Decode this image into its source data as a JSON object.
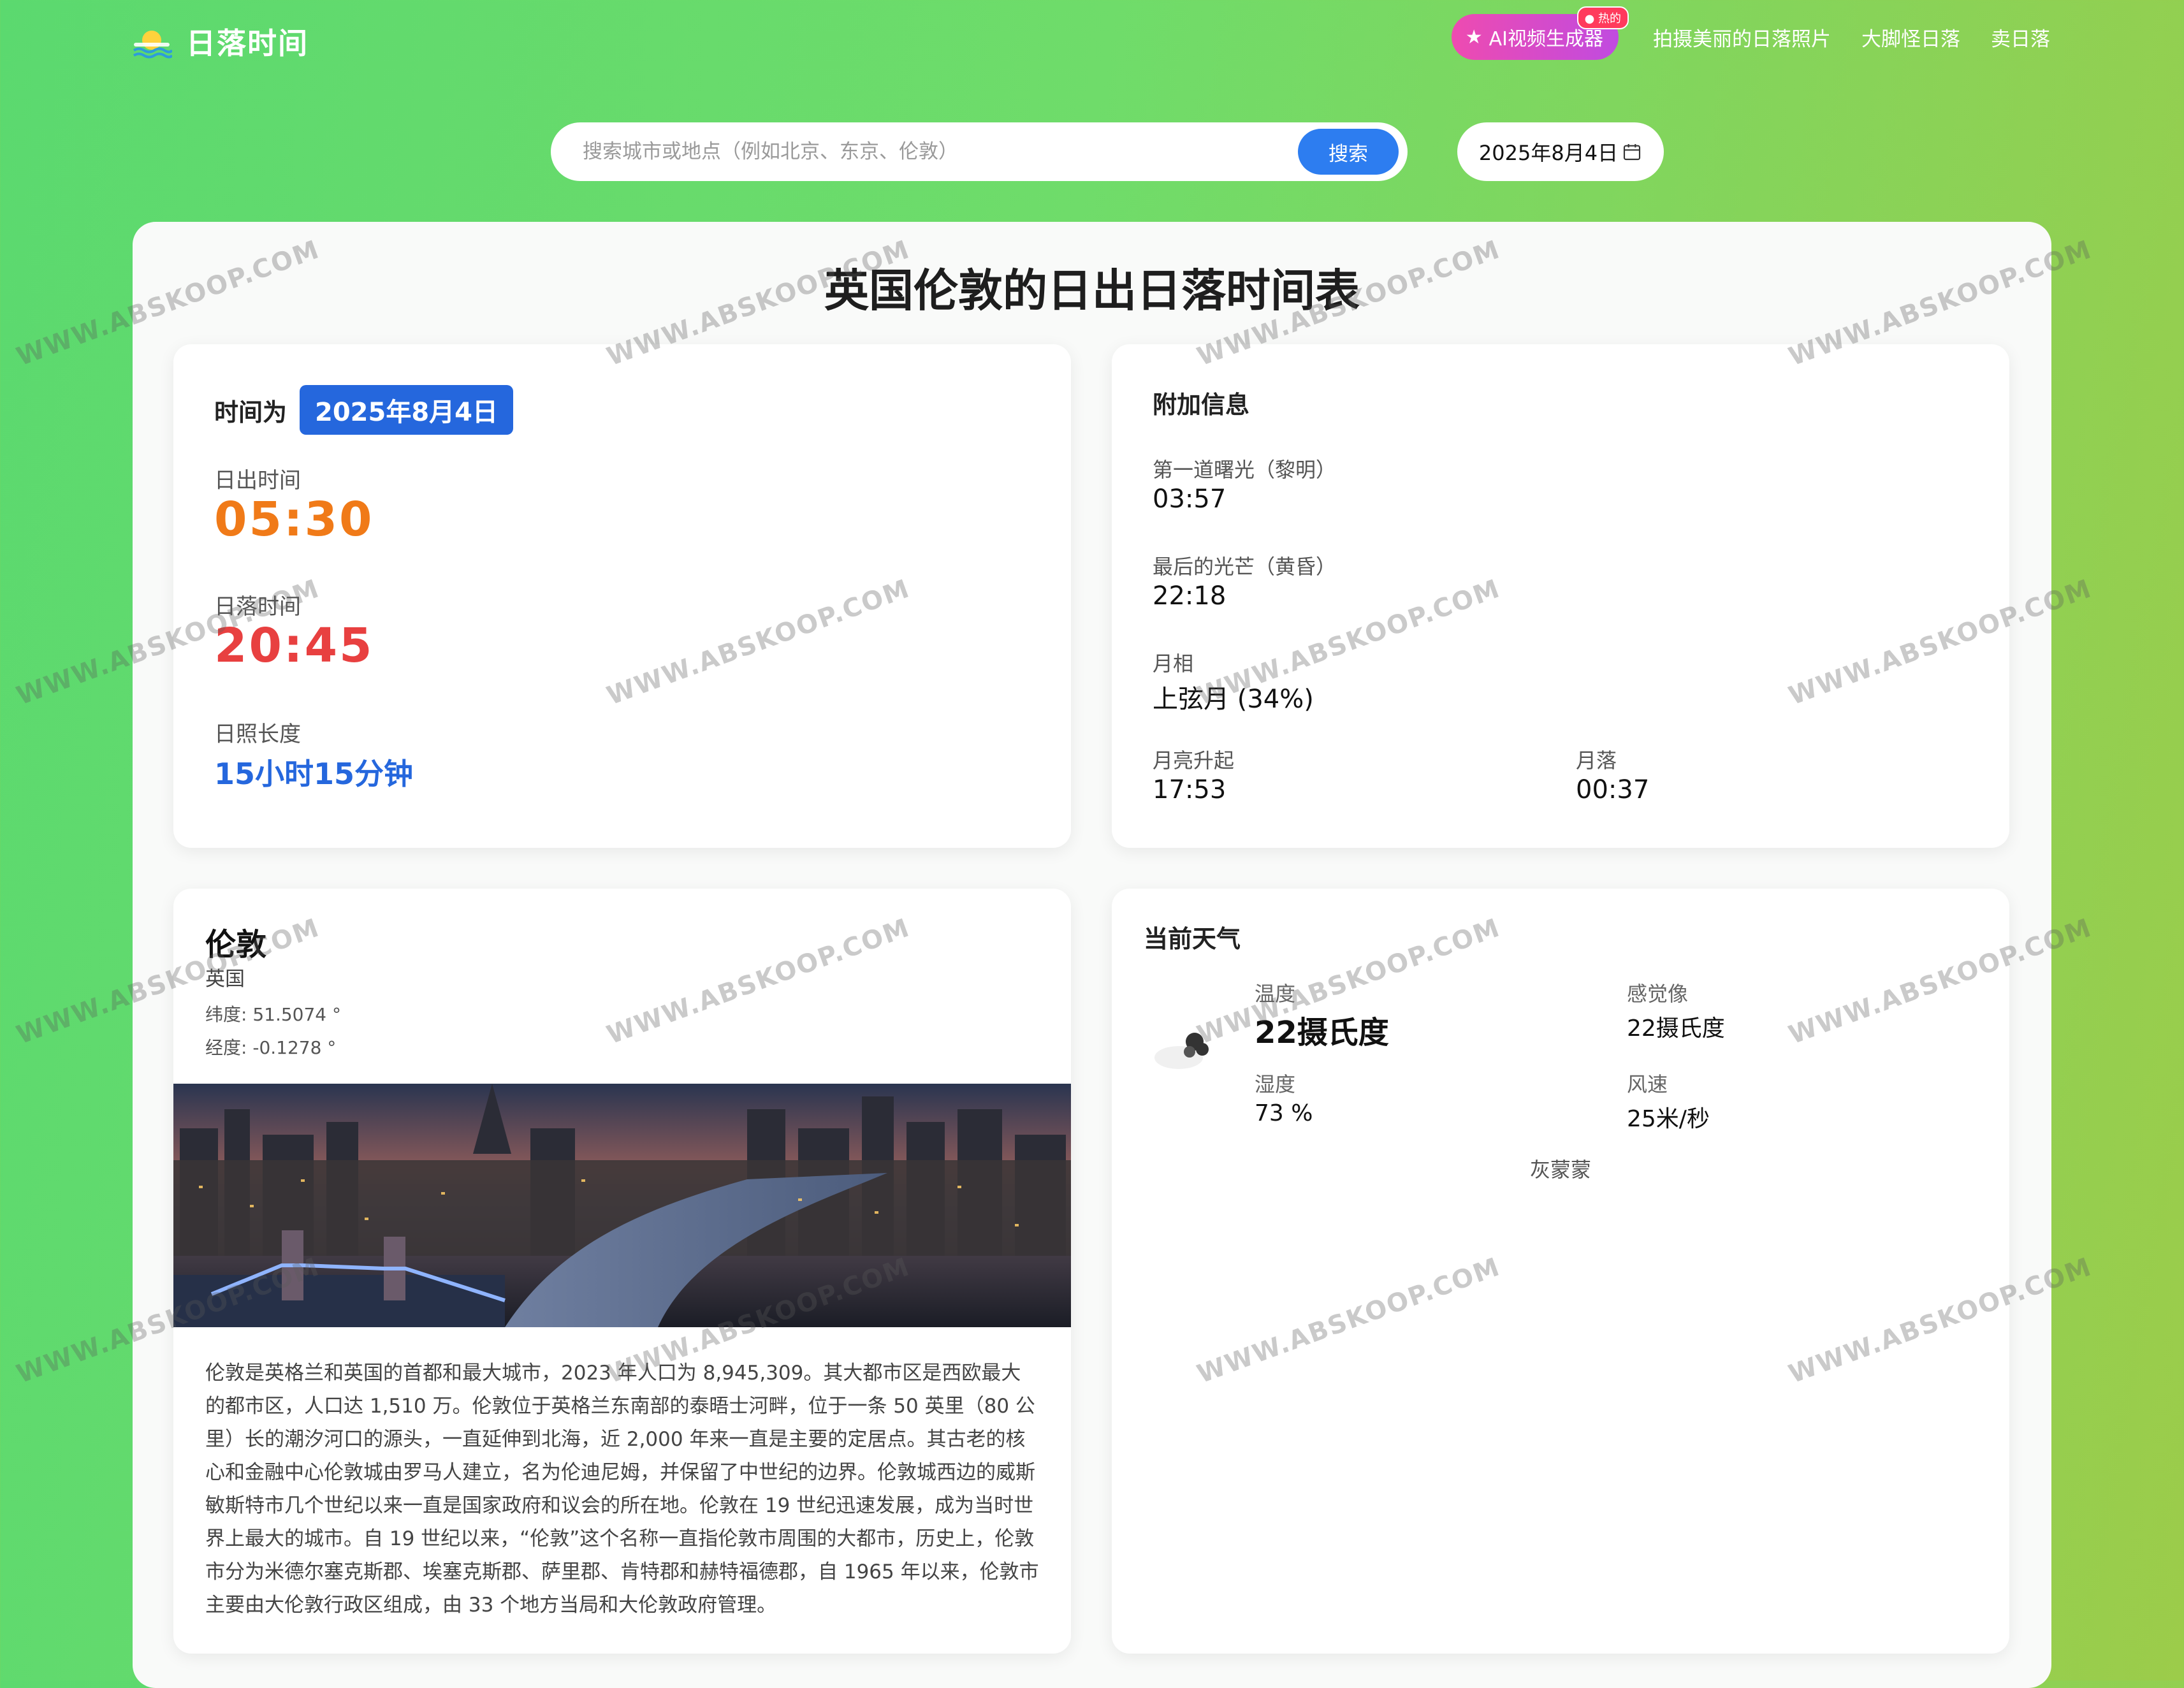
{
  "header": {
    "logo_text": "日落时间",
    "nav": {
      "ai_button": "AI视频生成器",
      "ai_badge": "热的",
      "photos": "拍摄美丽的日落照片",
      "bigfoot": "大脚怪日落",
      "sell": "卖日落"
    }
  },
  "search": {
    "placeholder": "搜索城市或地点（例如北京、东京、伦敦）",
    "button": "搜索"
  },
  "date_picker": {
    "value": "2025年8月4日"
  },
  "page_title": "英国伦敦的日出日落时间表",
  "sun_card": {
    "time_label": "时间为",
    "date": "2025年8月4日",
    "sunrise_label": "日出时间",
    "sunrise": "05:30",
    "sunset_label": "日落时间",
    "sunset": "20:45",
    "daylight_label": "日照长度",
    "daylight": "15小时15分钟"
  },
  "extra_card": {
    "title": "附加信息",
    "dawn_label": "第一道曙光（黎明）",
    "dawn": "03:57",
    "dusk_label": "最后的光芒（黄昏）",
    "dusk": "22:18",
    "moon_phase_label": "月相",
    "moon_phase": "上弦月 (34%)",
    "moonrise_label": "月亮升起",
    "moonrise": "17:53",
    "moonset_label": "月落",
    "moonset": "00:37"
  },
  "city_card": {
    "city": "伦敦",
    "country": "英国",
    "latitude": "纬度: 51.5074 °",
    "longitude": "经度: -0.1278 °",
    "description": "伦敦是英格兰和英国的首都和最大城市，2023 年人口为 8,945,309。其大都市区是西欧最大的都市区，人口达 1,510 万。伦敦位于英格兰东南部的泰晤士河畔，位于一条 50 英里（80 公里）长的潮汐河口的源头，一直延伸到北海，近 2,000 年来一直是主要的定居点。其古老的核心和金融中心伦敦城由罗马人建立，名为伦迪尼姆，并保留了中世纪的边界。伦敦城西边的威斯敏斯特市几个世纪以来一直是国家政府和议会的所在地。伦敦在 19 世纪迅速发展，成为当时世界上最大的城市。自 19 世纪以来，“伦敦”这个名称一直指伦敦市周围的大都市，历史上，伦敦市分为米德尔塞克斯郡、埃塞克斯郡、萨里郡、肯特郡和赫特福德郡，自 1965 年以来，伦敦市主要由大伦敦行政区组成，由 33 个地方当局和大伦敦政府管理。"
  },
  "weather_card": {
    "title": "当前天气",
    "temp_label": "温度",
    "temp": "22摄氏度",
    "feels_label": "感觉像",
    "feels": "22摄氏度",
    "humidity_label": "湿度",
    "humidity": "73 %",
    "wind_label": "风速",
    "wind": "25米/秒",
    "condition": "灰蒙蒙"
  },
  "watermark": "WWW.ABSKOOP.COM",
  "colors": {
    "accent_blue": "#2567dd",
    "sunrise_orange": "#f07a18",
    "sunset_red": "#e84040"
  }
}
